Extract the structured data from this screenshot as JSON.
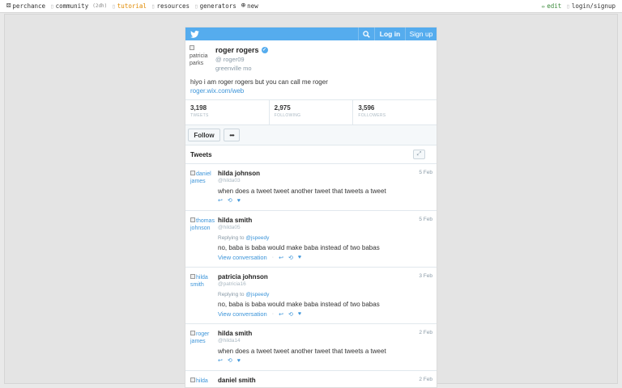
{
  "topbar": {
    "site": "perchance",
    "community": "community",
    "community_badge": "(2dh)",
    "tutorial": "tutorial",
    "resources": "resources",
    "generators": "generators",
    "new": "new",
    "edit": "edit",
    "login": "login/signup"
  },
  "header": {
    "login": "Log in",
    "signup": "Sign up"
  },
  "profile": {
    "avatar_alt": "patricia parks",
    "name": "roger rogers",
    "handle": "@ roger09",
    "location": "greenville mo",
    "bio": "hiyo i am roger rogers but you can call me roger",
    "url": "roger.wix.com/web"
  },
  "stats": [
    {
      "value": "3,198",
      "label": "TWEETS"
    },
    {
      "value": "2,975",
      "label": "FOLLOWING"
    },
    {
      "value": "3,596",
      "label": "FOLLOWERS"
    }
  ],
  "buttons": {
    "follow": "Follow",
    "more": "•••"
  },
  "tweets_title": "Tweets",
  "tweets": [
    {
      "avatar_alt": "daniel james",
      "name": "hilda johnson",
      "handle": "@hilda03",
      "date": "5 Feb",
      "reply_prefix": "",
      "reply_to": "",
      "text": "when does a tweet tweet another tweet that tweets a tweet",
      "conversation": ""
    },
    {
      "avatar_alt": "thomas johnson",
      "name": "hilda smith",
      "handle": "@hilda05",
      "date": "5 Feb",
      "reply_prefix": "Replying to",
      "reply_to": "@jspeedy",
      "text": "no, baba is baba would make baba instead of two babas",
      "conversation": "View conversation"
    },
    {
      "avatar_alt": "hilda smith",
      "name": "patricia johnson",
      "handle": "@patricia16",
      "date": "3 Feb",
      "reply_prefix": "Replying to",
      "reply_to": "@jspeedy",
      "text": "no, baba is baba would make baba instead of two babas",
      "conversation": "View conversation"
    },
    {
      "avatar_alt": "roger james",
      "name": "hilda smith",
      "handle": "@hilda14",
      "date": "2 Feb",
      "reply_prefix": "",
      "reply_to": "",
      "text": "when does a tweet tweet another tweet that tweets a tweet",
      "conversation": ""
    },
    {
      "avatar_alt": "hilda",
      "name": "daniel smith",
      "handle": "",
      "date": "2 Feb",
      "reply_prefix": "",
      "reply_to": "",
      "text": "",
      "conversation": ""
    }
  ],
  "colors": {
    "twitter_blue": "#55acee",
    "link_blue": "#3b94d9",
    "tutorial_orange": "#e08a00"
  }
}
